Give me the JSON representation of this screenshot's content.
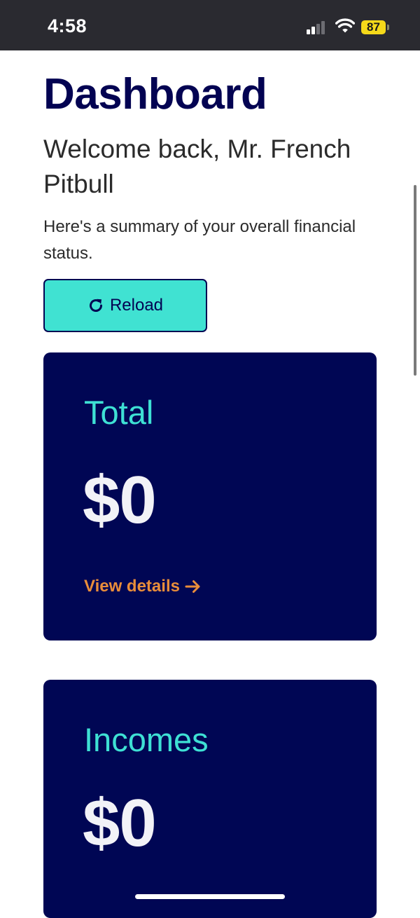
{
  "status_bar": {
    "time": "4:58",
    "battery": "87",
    "icons": [
      "cellular-signal-icon",
      "wifi-icon",
      "battery-icon"
    ]
  },
  "header": {
    "title": "Dashboard",
    "welcome": "Welcome back, Mr. French Pitbull",
    "summary": "Here's a summary of your overall financial status."
  },
  "reload": {
    "label": "Reload",
    "icon": "reload-icon"
  },
  "cards": [
    {
      "label": "Total",
      "value": "$0",
      "link": "View details"
    },
    {
      "label": "Incomes",
      "value": "$0"
    }
  ],
  "colors": {
    "title": "#030352",
    "accent_teal": "#40e2d2",
    "card_bg": "#000654",
    "link_orange": "#e98d3a",
    "battery": "#f5d91a"
  }
}
